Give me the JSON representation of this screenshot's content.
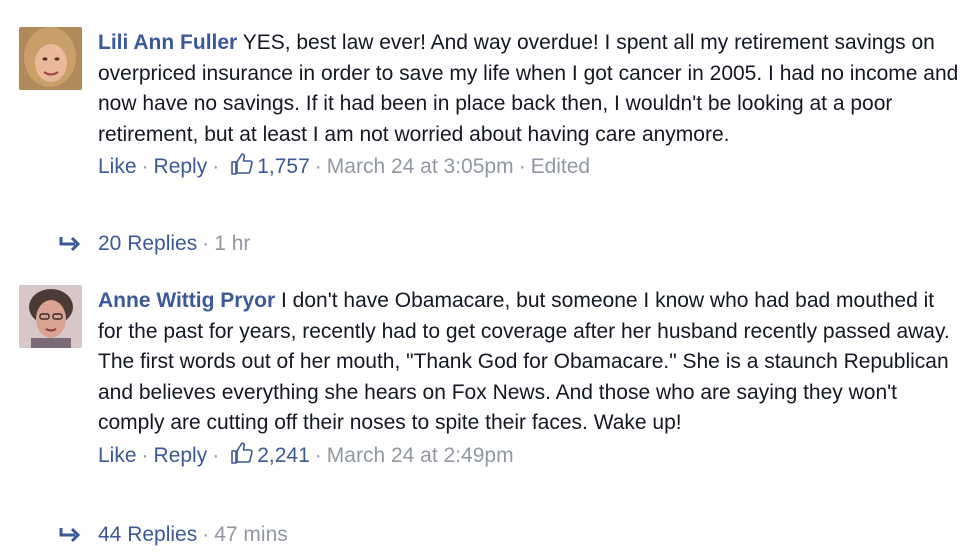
{
  "comments": [
    {
      "author": "Lili Ann Fuller",
      "text": "YES, best law ever! And way overdue! I spent all my retirement savings on overpriced insurance in order to save my life when I got cancer in 2005. I had no income and now have no savings. If it had been in place back then, I wouldn't be looking at a poor retirement, but at least I am not worried about having care anymore.",
      "like_label": "Like",
      "reply_label": "Reply",
      "likes": "1,757",
      "timestamp": "March 24 at 3:05pm",
      "edited": "Edited",
      "replies_label": "20 Replies",
      "replies_time": "1 hr"
    },
    {
      "author": "Anne Wittig Pryor",
      "text": "I don't have Obamacare, but someone I know who had bad mouthed it for the past for years, recently had to get coverage after her husband recently passed away. The first words out of her mouth, \"Thank God for Obamacare.\" She is a staunch Republican and believes everything she hears on Fox News. And those who are saying they won't comply are cutting off their noses to spite their faces. Wake up!",
      "like_label": "Like",
      "reply_label": "Reply",
      "likes": "2,241",
      "timestamp": "March 24 at 2:49pm",
      "replies_label": "44 Replies",
      "replies_time": "47 mins"
    }
  ],
  "colors": {
    "link": "#3b5998",
    "meta": "#9197a3",
    "text": "#141823"
  },
  "icons": [
    "thumbs-up-icon",
    "reply-arrow-icon",
    "avatar"
  ]
}
